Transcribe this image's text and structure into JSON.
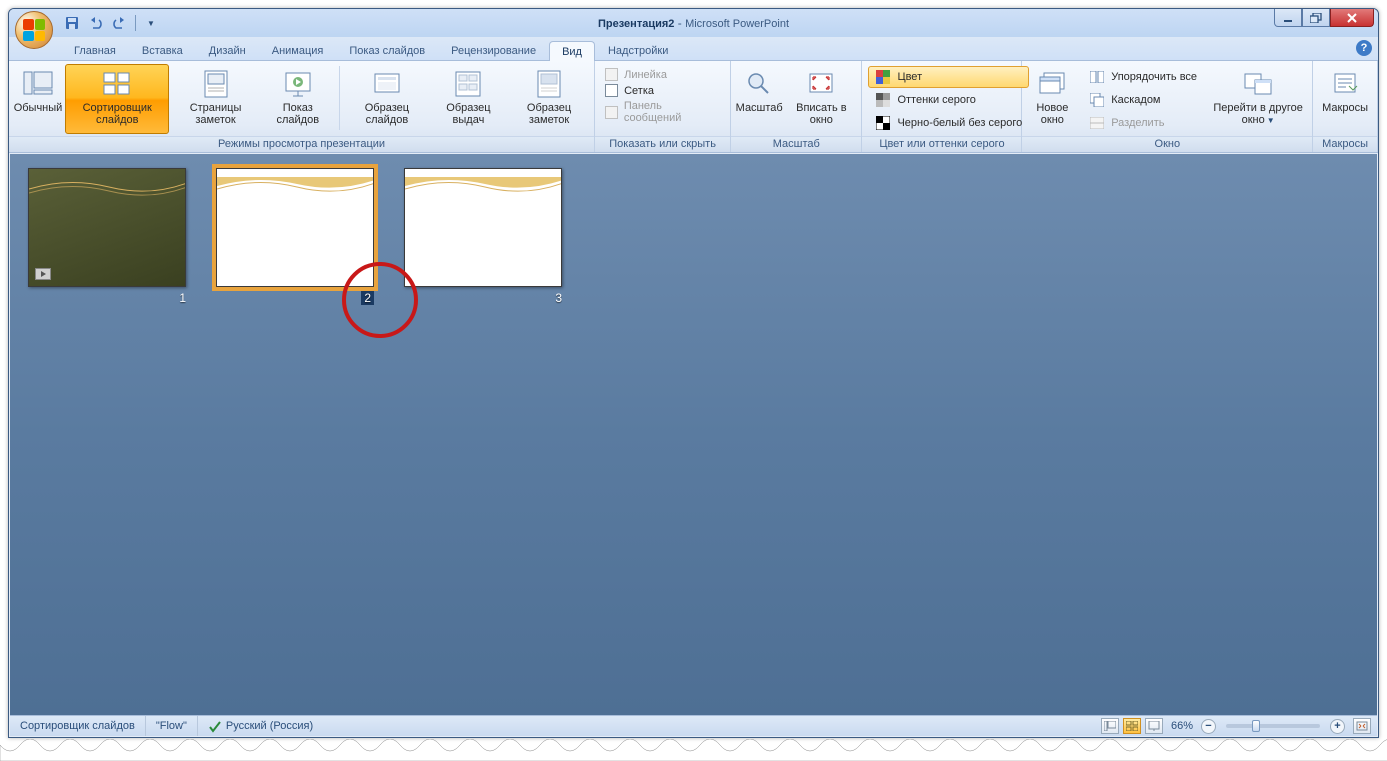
{
  "title": {
    "doc": "Презентация2",
    "app": "Microsoft PowerPoint"
  },
  "qat": {
    "save": "save-icon",
    "undo": "undo-icon",
    "redo": "redo-icon",
    "custom": "customize-qat"
  },
  "tabs": [
    {
      "label": "Главная"
    },
    {
      "label": "Вставка"
    },
    {
      "label": "Дизайн"
    },
    {
      "label": "Анимация"
    },
    {
      "label": "Показ слайдов"
    },
    {
      "label": "Рецензирование"
    },
    {
      "label": "Вид",
      "active": true
    },
    {
      "label": "Надстройки"
    }
  ],
  "ribbon": {
    "views": {
      "label": "Режимы просмотра презентации",
      "items": [
        {
          "label": "Обычный"
        },
        {
          "label": "Сортировщик слайдов",
          "selected": true
        },
        {
          "label": "Страницы заметок"
        },
        {
          "label": "Показ слайдов"
        },
        {
          "label": "Образец слайдов"
        },
        {
          "label": "Образец выдач"
        },
        {
          "label": "Образец заметок"
        }
      ]
    },
    "showhide": {
      "label": "Показать или скрыть",
      "items": [
        {
          "label": "Линейка",
          "disabled": true
        },
        {
          "label": "Сетка"
        },
        {
          "label": "Панель сообщений",
          "disabled": true
        }
      ]
    },
    "zoom": {
      "label": "Масштаб",
      "zoom_label": "Масштаб",
      "fit_label": "Вписать в окно"
    },
    "color": {
      "label": "Цвет или оттенки серого",
      "items": [
        {
          "label": "Цвет",
          "highlighted": true
        },
        {
          "label": "Оттенки серого"
        },
        {
          "label": "Черно-белый без серого"
        }
      ]
    },
    "window": {
      "label": "Окно",
      "new_label": "Новое окно",
      "arrange": "Упорядочить все",
      "cascade": "Каскадом",
      "split": "Разделить",
      "move_label": "Перейти в другое окно"
    },
    "macros": {
      "label": "Макросы",
      "btn_label": "Макросы"
    }
  },
  "slides": [
    {
      "num": "1",
      "dark": true,
      "play": true
    },
    {
      "num": "2",
      "selected": true
    },
    {
      "num": "3"
    }
  ],
  "status": {
    "view": "Сортировщик слайдов",
    "theme": "\"Flow\"",
    "lang": "Русский (Россия)",
    "zoom": "66%"
  }
}
